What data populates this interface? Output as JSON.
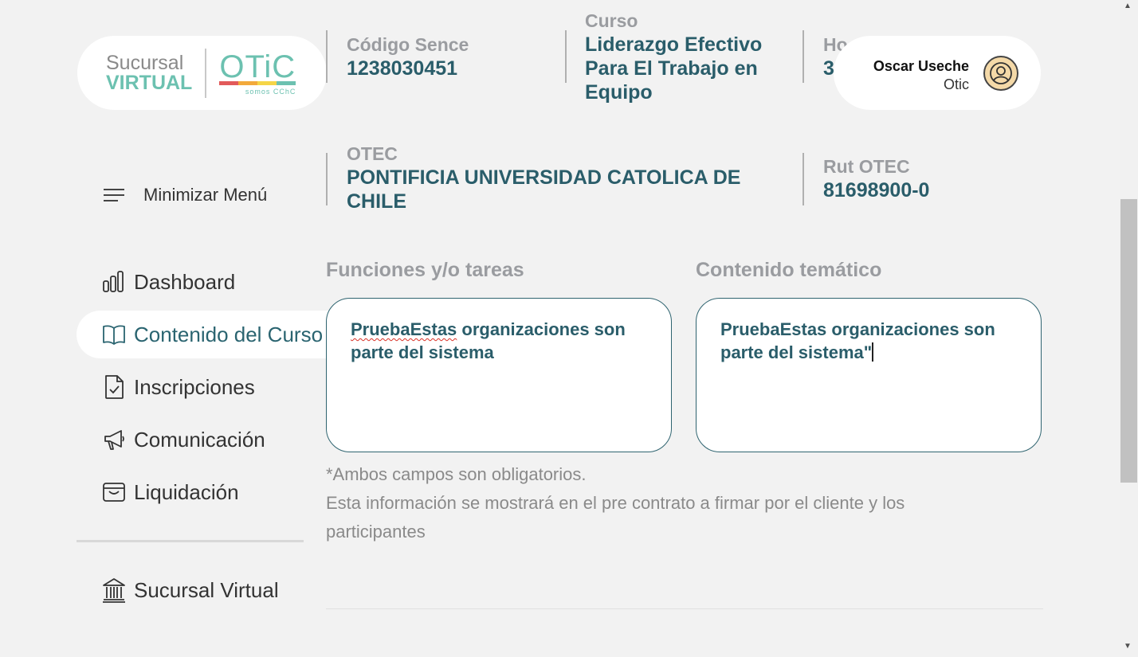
{
  "logo": {
    "line1": "Sucursal",
    "line2": "VIRTUAL",
    "brand": "OTiC",
    "tagline": "somos CChC",
    "bar_colors": [
      "#e25a5a",
      "#f2a93b",
      "#f5d547",
      "#6cc1b0"
    ]
  },
  "course": {
    "codigo_label": "Código Sence",
    "codigo_value": "1238030451",
    "curso_label": "Curso",
    "curso_value": "Liderazgo Efectivo Para El Trabajo en Equipo",
    "horas_label_partial": "Ho",
    "horas_value_partial": "3",
    "otec_label": "OTEC",
    "otec_value": "PONTIFICIA UNIVERSIDAD CATOLICA DE CHILE",
    "rut_label": "Rut OTEC",
    "rut_value": "81698900-0"
  },
  "user": {
    "name": "Oscar Useche",
    "org": "Otic"
  },
  "menu": {
    "toggle_label": "Minimizar Menú",
    "items": [
      {
        "label": "Dashboard",
        "icon": "bar-chart-icon"
      },
      {
        "label": "Contenido del Curso",
        "icon": "book-icon",
        "active": true
      },
      {
        "label": "Inscripciones",
        "icon": "document-check-icon"
      },
      {
        "label": "Comunicación",
        "icon": "megaphone-icon"
      },
      {
        "label": "Liquidación",
        "icon": "wallet-icon"
      }
    ],
    "footer_item": {
      "label": "Sucursal Virtual",
      "icon": "bank-icon"
    }
  },
  "form": {
    "funciones_label": "Funciones y/o tareas",
    "funciones_misspelled": "PruebaEstas",
    "funciones_rest": " organizaciones son parte del sistema",
    "contenido_label": "Contenido temático",
    "contenido_value": "PruebaEstas organizaciones son parte del sistema\"",
    "note_required": "*Ambos campos son obligatorios.",
    "note_info": "Esta información se mostrará en el pre contrato a firmar por el cliente y los participantes"
  },
  "colors": {
    "accent": "#2a5d6a",
    "brand_teal": "#6cc1b0",
    "label_gray": "#9a9ca0",
    "background": "#f2f2f2"
  }
}
